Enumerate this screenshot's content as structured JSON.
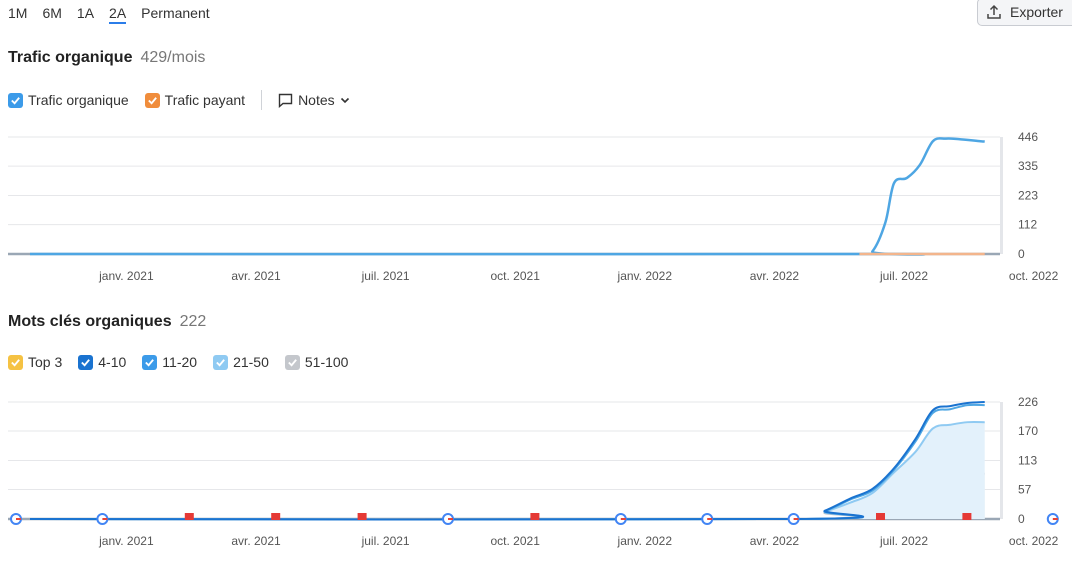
{
  "periods": [
    {
      "label": "1M",
      "active": false
    },
    {
      "label": "6M",
      "active": false
    },
    {
      "label": "1A",
      "active": false
    },
    {
      "label": "2A",
      "active": true
    },
    {
      "label": "Permanent",
      "active": false
    }
  ],
  "export_label": "Exporter",
  "traffic": {
    "title": "Trafic organique",
    "value": "429/mois",
    "legend": [
      {
        "label": "Trafic organique",
        "color": "#3c9be9"
      },
      {
        "label": "Trafic payant",
        "color": "#f08d3c"
      }
    ],
    "notes_label": "Notes"
  },
  "keywords": {
    "title": "Mots clés organiques",
    "value": "222",
    "legend": [
      {
        "label": "Top 3",
        "color": "#f5c243"
      },
      {
        "label": "4-10",
        "color": "#1a73d0"
      },
      {
        "label": "11-20",
        "color": "#3c9be9"
      },
      {
        "label": "21-50",
        "color": "#8fcaf2"
      },
      {
        "label": "51-100",
        "color": "#c4c7cc"
      }
    ]
  },
  "chart_data": [
    {
      "type": "line",
      "x_ticks": [
        "janv. 2021",
        "avr. 2021",
        "juil. 2021",
        "oct. 2021",
        "janv. 2022",
        "avr. 2022",
        "juil. 2022",
        "oct. 2022"
      ],
      "y_ticks": [
        0,
        112,
        223,
        335,
        446
      ],
      "ylim": [
        0,
        446
      ],
      "series": [
        {
          "name": "Trafic organique",
          "color": "#4ea6e3",
          "points": [
            [
              0,
              0
            ],
            [
              19.2,
              0
            ],
            [
              19.5,
              10
            ],
            [
              19.8,
              120
            ],
            [
              20.0,
              270
            ],
            [
              20.3,
              290
            ],
            [
              20.6,
              340
            ],
            [
              20.9,
              430
            ],
            [
              21.2,
              440
            ],
            [
              21.5,
              438
            ],
            [
              22.0,
              430
            ],
            [
              22.1,
              429
            ]
          ]
        },
        {
          "name": "Trafic payant",
          "color": "#f3b58c",
          "points": [
            [
              19.2,
              0
            ],
            [
              22.1,
              0
            ]
          ]
        }
      ]
    },
    {
      "type": "area",
      "x_ticks": [
        "janv. 2021",
        "avr. 2021",
        "juil. 2021",
        "oct. 2021",
        "janv. 2022",
        "avr. 2022",
        "juil. 2022",
        "oct. 2022"
      ],
      "y_ticks": [
        0,
        57,
        113,
        170,
        226
      ],
      "ylim": [
        0,
        226
      ],
      "series": [
        {
          "name": "51-100",
          "color": "#b9bcc2",
          "points": [
            [
              0,
              0
            ],
            [
              17.8,
              0
            ],
            [
              18.4,
              12
            ],
            [
              19.0,
              22
            ],
            [
              19.5,
              40
            ],
            [
              20.0,
              60
            ],
            [
              20.6,
              65
            ],
            [
              21.2,
              70
            ],
            [
              21.7,
              82
            ],
            [
              22.1,
              88
            ]
          ]
        },
        {
          "name": "21-50",
          "color": "#8fcaf2",
          "points": [
            [
              0,
              0
            ],
            [
              17.8,
              0
            ],
            [
              18.4,
              14
            ],
            [
              19.0,
              32
            ],
            [
              19.5,
              50
            ],
            [
              20.0,
              90
            ],
            [
              20.5,
              130
            ],
            [
              20.9,
              175
            ],
            [
              21.3,
              182
            ],
            [
              21.7,
              187
            ],
            [
              22.1,
              187
            ]
          ]
        },
        {
          "name": "11-20",
          "color": "#4ea6e3",
          "points": [
            [
              0,
              0
            ],
            [
              17.8,
              0
            ],
            [
              18.4,
              15
            ],
            [
              19.0,
              38
            ],
            [
              19.5,
              55
            ],
            [
              20.0,
              95
            ],
            [
              20.5,
              150
            ],
            [
              20.9,
              205
            ],
            [
              21.3,
              212
            ],
            [
              21.7,
              220
            ],
            [
              22.1,
              220
            ]
          ]
        },
        {
          "name": "4-10",
          "color": "#1a73d0",
          "points": [
            [
              0,
              0
            ],
            [
              17.8,
              0
            ],
            [
              18.4,
              16
            ],
            [
              19.0,
              40
            ],
            [
              19.5,
              58
            ],
            [
              20.0,
              98
            ],
            [
              20.5,
              155
            ],
            [
              20.9,
              210
            ],
            [
              21.3,
              218
            ],
            [
              21.7,
              224
            ],
            [
              22.1,
              226
            ]
          ]
        }
      ],
      "markers": {
        "google": [
          0.0,
          1.0,
          5.0,
          7.0,
          8.0,
          9.0,
          12.0,
          18.0
        ],
        "flag": [
          2.0,
          3.0,
          4.0,
          6.0,
          10.0,
          11.0,
          13.0,
          14.0,
          15.0,
          16.0,
          17.0,
          19.0,
          20.0,
          21.0
        ]
      }
    }
  ]
}
